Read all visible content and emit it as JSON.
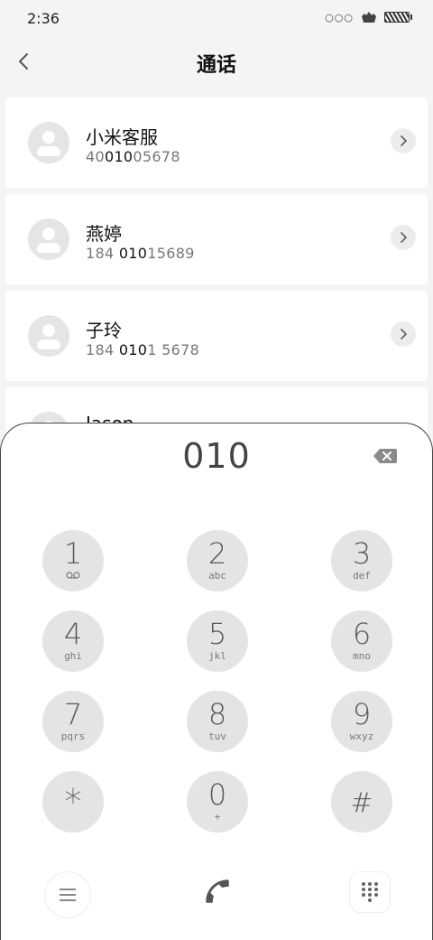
{
  "status": {
    "time": "2:36",
    "dots": "○○○"
  },
  "header": {
    "title": "通话"
  },
  "contacts": [
    {
      "name": "小米客服",
      "number_parts": [
        "40",
        "010",
        "05678"
      ]
    },
    {
      "name": "燕婷",
      "number_parts": [
        "184 ",
        "010",
        "15689"
      ]
    },
    {
      "name": "子玲",
      "number_parts": [
        "184 ",
        "010",
        "1 5678"
      ]
    },
    {
      "name": "Jason",
      "number_parts": [
        "",
        "",
        ""
      ]
    }
  ],
  "dialer": {
    "number": "010",
    "keys": [
      {
        "digit": "1",
        "letters": ""
      },
      {
        "digit": "2",
        "letters": "abc"
      },
      {
        "digit": "3",
        "letters": "def"
      },
      {
        "digit": "4",
        "letters": "ghi"
      },
      {
        "digit": "5",
        "letters": "jkl"
      },
      {
        "digit": "6",
        "letters": "mno"
      },
      {
        "digit": "7",
        "letters": "pqrs"
      },
      {
        "digit": "8",
        "letters": "tuv"
      },
      {
        "digit": "9",
        "letters": "wxyz"
      },
      {
        "digit": "*",
        "letters": ""
      },
      {
        "digit": "0",
        "letters": "+"
      },
      {
        "digit": "#",
        "letters": ""
      }
    ]
  },
  "icons": {
    "back": "chevron-left-icon",
    "backspace": "backspace-icon",
    "menu": "menu-icon",
    "call": "phone-icon",
    "keypad": "dialpad-icon",
    "voicemail": "voicemail-icon",
    "contact_detail": "chevron-right-icon"
  },
  "colors": {
    "call_icon": "#555555",
    "key_bg": "#e4e4e4",
    "avatar_bg": "#e5e5e8"
  }
}
